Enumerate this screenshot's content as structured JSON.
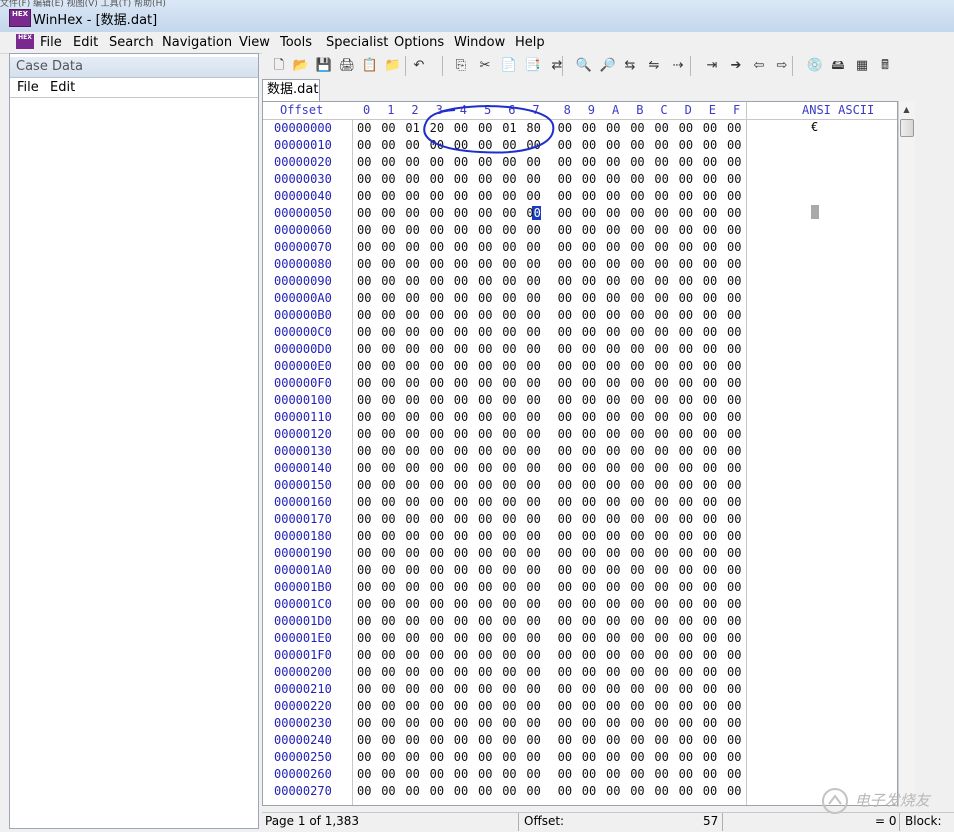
{
  "window": {
    "title": "WinHex - [数据.dat]",
    "app_icon_text": "HEX",
    "overlay_text": "文件(F)  编辑(E)  视图(V)  工具(T)  帮助(H)"
  },
  "menu": [
    "File",
    "Edit",
    "Search",
    "Navigation",
    "View",
    "Tools",
    "Specialist",
    "Options",
    "Window",
    "Help"
  ],
  "case_panel": {
    "title": "Case Data",
    "menu": [
      "File",
      "Edit"
    ]
  },
  "toolbar_icons": [
    "new-file-icon",
    "open-file-icon",
    "save-icon",
    "print-icon",
    "properties-icon",
    "open-folder-icon",
    "undo-icon",
    "copy-icon",
    "cut-icon",
    "paste-icon",
    "paste-special-icon",
    "convert-icon",
    "find-text-icon",
    "find-hex-icon",
    "replace-text-icon",
    "replace-hex-icon",
    "find-next-icon",
    "goto-offset-icon",
    "goto-icon",
    "back-arrow-icon",
    "forward-arrow-icon",
    "open-disk-icon",
    "drive-icon",
    "ram-icon",
    "calculator-icon"
  ],
  "file_tab": "数据.dat",
  "editor": {
    "offset_header": "Offset",
    "col_headers": [
      "0",
      "1",
      "2",
      "3",
      "4",
      "5",
      "6",
      "7",
      "8",
      "9",
      "A",
      "B",
      "C",
      "D",
      "E",
      "F"
    ],
    "ascii_header": "ANSI ASCII",
    "offsets": [
      "00000000",
      "00000010",
      "00000020",
      "00000030",
      "00000040",
      "00000050",
      "00000060",
      "00000070",
      "00000080",
      "00000090",
      "000000A0",
      "000000B0",
      "000000C0",
      "000000D0",
      "000000E0",
      "000000F0",
      "00000100",
      "00000110",
      "00000120",
      "00000130",
      "00000140",
      "00000150",
      "00000160",
      "00000170",
      "00000180",
      "00000190",
      "000001A0",
      "000001B0",
      "000001C0",
      "000001D0",
      "000001E0",
      "000001F0",
      "00000200",
      "00000210",
      "00000220",
      "00000230",
      "00000240",
      "00000250",
      "00000260",
      "00000270"
    ],
    "rows": [
      [
        "00",
        "00",
        "01",
        "20",
        "00",
        "00",
        "01",
        "80",
        "00",
        "00",
        "00",
        "00",
        "00",
        "00",
        "00",
        "00"
      ]
    ],
    "default_byte": "00",
    "row_count": 40,
    "ascii_first_row": "€",
    "cursor_byte": "0"
  },
  "status": {
    "page": "Page 1 of 1,383",
    "offset_label": "Offset:",
    "offset_value": "57",
    "selection": "= 0",
    "block": "Block:"
  },
  "watermark": "电子发烧友",
  "colors": {
    "offset_text": "#2222b8",
    "header_text": "#3b3bc8",
    "annotation": "#1f2fcc",
    "cursor": "#1a3dbf"
  }
}
